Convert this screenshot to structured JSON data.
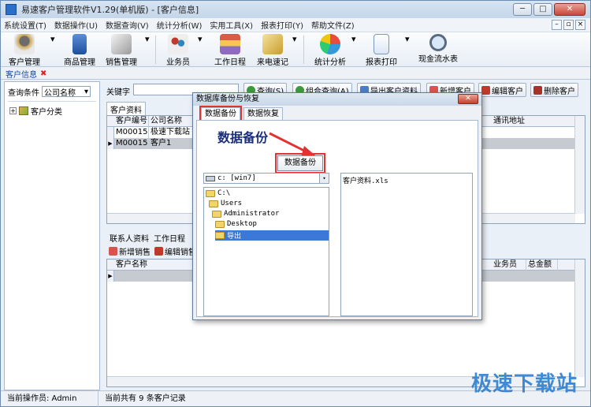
{
  "window": {
    "title": "易速客户管理软件V1.29(单机版) - [客户信息]",
    "min": "─",
    "max": "□",
    "close": "✕"
  },
  "menu": [
    "系统设置(T)",
    "数据操作(U)",
    "数据查询(V)",
    "统计分析(W)",
    "实用工具(X)",
    "报表打印(Y)",
    "帮助文件(Z)"
  ],
  "mdi": {
    "min": "–",
    "restore": "▫",
    "close": "×"
  },
  "toolbar": {
    "customer_mgmt": "客户管理",
    "product_mgmt": "商品管理",
    "sales_mgmt": "销售管理",
    "salesperson": "业务员",
    "schedule": "工作日程",
    "call_log": "来电速记",
    "stats": "统计分析",
    "report": "报表打印",
    "cashflow": "现金流水表",
    "dropdown": "▾"
  },
  "page_tab": {
    "label": "客户信息",
    "close": "✖"
  },
  "search": {
    "label": "查询条件",
    "field": "公司名称",
    "keyword_label": "关键字",
    "keyword_value": ""
  },
  "actions": {
    "query": "查询(S)",
    "combo_query": "组合查询(A)",
    "export": "导出客户资料",
    "add": "新增客户",
    "edit": "编辑客户",
    "delete": "删除客户"
  },
  "tree": {
    "root": "客户分类",
    "expander": "+"
  },
  "customer_tab": "客户资料",
  "customer_grid": {
    "columns": [
      "客户编号",
      "公司名称",
      "通讯地址"
    ],
    "rows": [
      {
        "id": "M000157",
        "name": "极速下载站"
      },
      {
        "id": "M000158",
        "name": "客户1"
      }
    ]
  },
  "lower_tabs": [
    "联系人资料",
    "工作日程"
  ],
  "lower_actions": {
    "add_sale": "新增销售",
    "edit_sale": "编辑销售"
  },
  "sales_grid": {
    "columns": [
      "客户名称",
      "业务员",
      "总金额"
    ]
  },
  "status": {
    "operator": "当前操作员: Admin",
    "count": "当前共有 9 条客户记录"
  },
  "dialog": {
    "title": "数据库备份与恢复",
    "close": "✕",
    "tabs": [
      "数据备份",
      "数据恢复"
    ],
    "heading": "数据备份",
    "backup_button": "数据备份",
    "drive": "c: [win7]",
    "dirs": [
      "C:\\",
      "Users",
      "Administrator",
      "Desktop",
      "导出"
    ],
    "files": [
      "客户资料.xls"
    ]
  },
  "watermark": "极速下载站"
}
